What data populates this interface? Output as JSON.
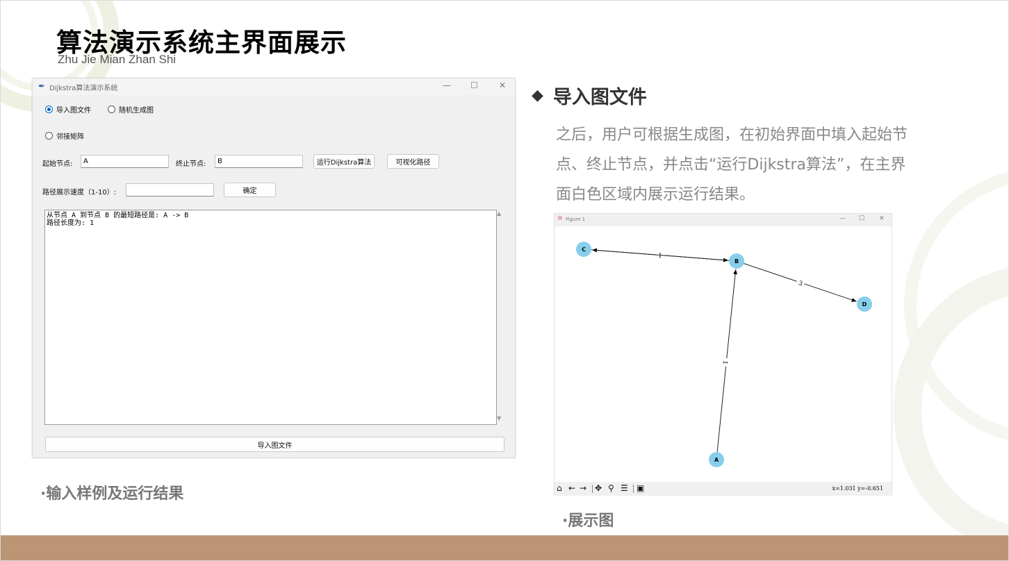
{
  "slide": {
    "title": "算法演示系统主界面展示",
    "subtitle": "Zhu Jie Mian Zhan Shi",
    "caption_left": "·输入样例及运行结果",
    "caption_right": "·展示图",
    "accent_color": "#bc9674"
  },
  "app_window": {
    "title": "Dijkstra算法演示系统",
    "controls": {
      "minimize": "—",
      "maximize": "☐",
      "close": "✕"
    },
    "radios": [
      {
        "label": "导入图文件",
        "selected": true
      },
      {
        "label": "随机生成图",
        "selected": false
      },
      {
        "label": "邻接矩阵",
        "selected": false
      }
    ],
    "start_label": "起始节点:",
    "start_value": "A",
    "end_label": "终止节点:",
    "end_value": "B",
    "run_button": "运行Dijkstra算法",
    "visualize_button": "可视化路径",
    "speed_label": "路径展示速度（1-10）:",
    "speed_value": "",
    "confirm_button": "确定",
    "output_text": "从节点 A 到节点 B 的最短路径是: A -> B\n路径长度为: 1",
    "bottom_button": "导入图文件"
  },
  "description": {
    "heading": "导入图文件",
    "paragraph": "之后，用户可根据生成图，在初始界面中填入起始节点、终止节点，并点击“运行Dijkstra算法”，在主界面白色区域内展示运行结果。"
  },
  "figure_window": {
    "title": "Figure 1",
    "controls": {
      "minimize": "—",
      "maximize": "☐",
      "close": "✕"
    },
    "toolbar_icons": [
      "home-icon",
      "back-icon",
      "forward-icon",
      "pan-icon",
      "zoom-icon",
      "configure-icon",
      "save-icon"
    ],
    "coord_readout": "x=1.031 y=-0.651",
    "node_color": "#87ceeb",
    "graph": {
      "nodes": [
        "A",
        "B",
        "C",
        "D"
      ],
      "edges": [
        {
          "from": "B",
          "to": "C",
          "weight": "1"
        },
        {
          "from": "C",
          "to": "B",
          "weight": "1"
        },
        {
          "from": "B",
          "to": "D",
          "weight": "3"
        },
        {
          "from": "A",
          "to": "B",
          "weight": "1"
        }
      ]
    }
  }
}
